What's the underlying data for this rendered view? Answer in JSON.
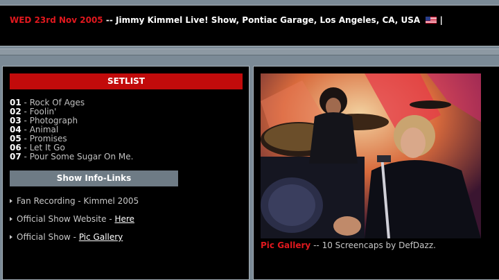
{
  "header": {
    "date": "WED 23rd Nov 2005",
    "separator": "--",
    "event": "Jimmy Kimmel Live! Show, Pontiac Garage, Los Angeles, CA, USA",
    "trailing": "|"
  },
  "setlist": {
    "heading": "SETLIST",
    "songs": [
      {
        "num": "01",
        "title": "Rock Of Ages"
      },
      {
        "num": "02",
        "title": "Foolin'"
      },
      {
        "num": "03",
        "title": "Photograph"
      },
      {
        "num": "04",
        "title": "Animal"
      },
      {
        "num": "05",
        "title": "Promises"
      },
      {
        "num": "06",
        "title": "Let It Go"
      },
      {
        "num": "07",
        "title": "Pour Some Sugar On Me."
      }
    ],
    "song_separator": "-"
  },
  "info": {
    "button_label": "Show Info-Links",
    "links": [
      {
        "text": "Fan Recording - Kimmel 2005",
        "link": ""
      },
      {
        "text": "Official Show Website - ",
        "link": "Here"
      },
      {
        "text": "Official Show - ",
        "link": "Pic Gallery"
      }
    ]
  },
  "gallery": {
    "label": "Pic Gallery",
    "caption": "-- 10 Screencaps by DefDazz."
  },
  "colors": {
    "accent_red": "#c20b0b",
    "page_bg": "#7b8a96",
    "panel_bg": "#000000"
  }
}
